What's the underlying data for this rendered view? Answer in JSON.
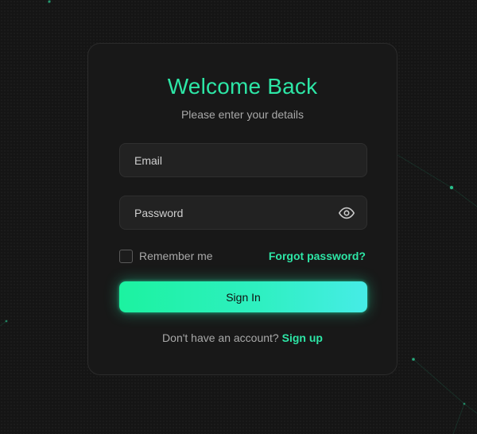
{
  "login": {
    "title": "Welcome Back",
    "subtitle": "Please enter your details",
    "email_placeholder": "Email",
    "password_placeholder": "Password",
    "remember_label": "Remember me",
    "forgot_label": "Forgot password?",
    "signin_label": "Sign In",
    "signup_prompt": "Don't have an account?",
    "signup_label": "Sign up"
  },
  "theme": {
    "accent": "#2de6a6",
    "background": "#151515",
    "card": "#181818",
    "button_gradient_start": "#1cf2a0",
    "button_gradient_end": "#46ece6"
  },
  "icons": {
    "password_toggle": "eye-icon"
  }
}
